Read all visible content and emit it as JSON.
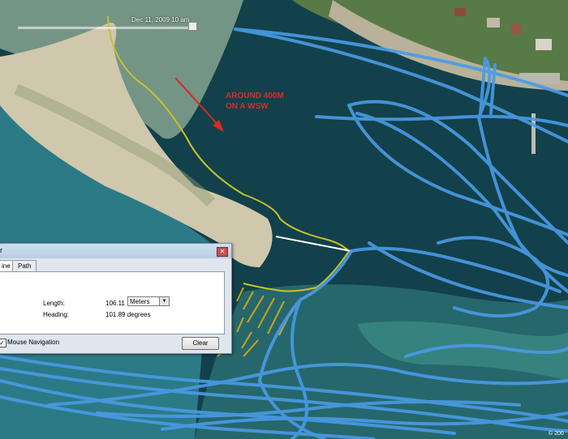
{
  "timeslider": {
    "date_label": "Dec 11, 2009  10 am"
  },
  "annotation": {
    "text": "AROUND 400M\nON A WSW"
  },
  "dialog": {
    "tabs": [
      "ine",
      "Path"
    ],
    "length_label": "Length:",
    "length_value": "106.11",
    "length_unit": "Meters",
    "heading_label": "Heading:",
    "heading_value": "101.89 degrees",
    "mouse_nav_label": "Mouse Navigation",
    "clear_label": "Clear"
  },
  "footer": {
    "copyright": "© 200"
  },
  "colors": {
    "water": "#143f4a",
    "sand": "#c9c0a5",
    "track": "#4a9be6",
    "path": "#c9c12a",
    "annotation": "#e3262c"
  }
}
